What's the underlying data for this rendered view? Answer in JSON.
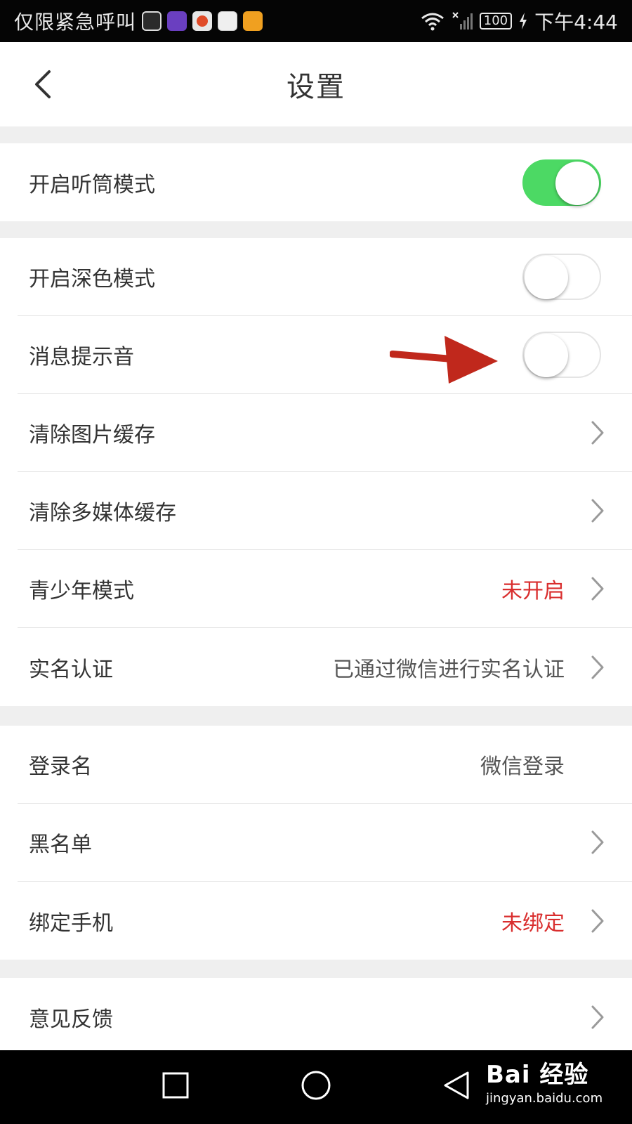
{
  "status_bar": {
    "emergency_text": "仅限紧急呼叫",
    "battery": "100",
    "time": "下午4:44",
    "notification_icons": [
      "monitor-icon",
      "purple-app-icon",
      "weibo-icon",
      "sina-icon",
      "sohu-icon"
    ]
  },
  "header": {
    "title": "设置",
    "back_icon": "chevron-left-icon"
  },
  "settings": {
    "earpiece_mode": {
      "label": "开启听筒模式",
      "toggle_on": true
    },
    "dark_mode": {
      "label": "开启深色模式",
      "toggle_on": false
    },
    "message_sound": {
      "label": "消息提示音",
      "toggle_on": false
    },
    "clear_image_cache": {
      "label": "清除图片缓存"
    },
    "clear_media_cache": {
      "label": "清除多媒体缓存"
    },
    "youth_mode": {
      "label": "青少年模式",
      "value": "未开启"
    },
    "real_name": {
      "label": "实名认证",
      "value": "已通过微信进行实名认证"
    },
    "login_name": {
      "label": "登录名",
      "value": "微信登录"
    },
    "blacklist": {
      "label": "黑名单"
    },
    "bind_phone": {
      "label": "绑定手机",
      "value": "未绑定"
    },
    "feedback": {
      "label": "意见反馈"
    }
  },
  "colors": {
    "toggle_on": "#4cd964",
    "value_red": "#d92e2e",
    "annotation_arrow": "#c0281c"
  },
  "system_nav": [
    "recent-apps-icon",
    "home-icon",
    "back-icon"
  ],
  "watermark": {
    "logo": "Bai 经验",
    "url": "jingyan.baidu.com"
  }
}
